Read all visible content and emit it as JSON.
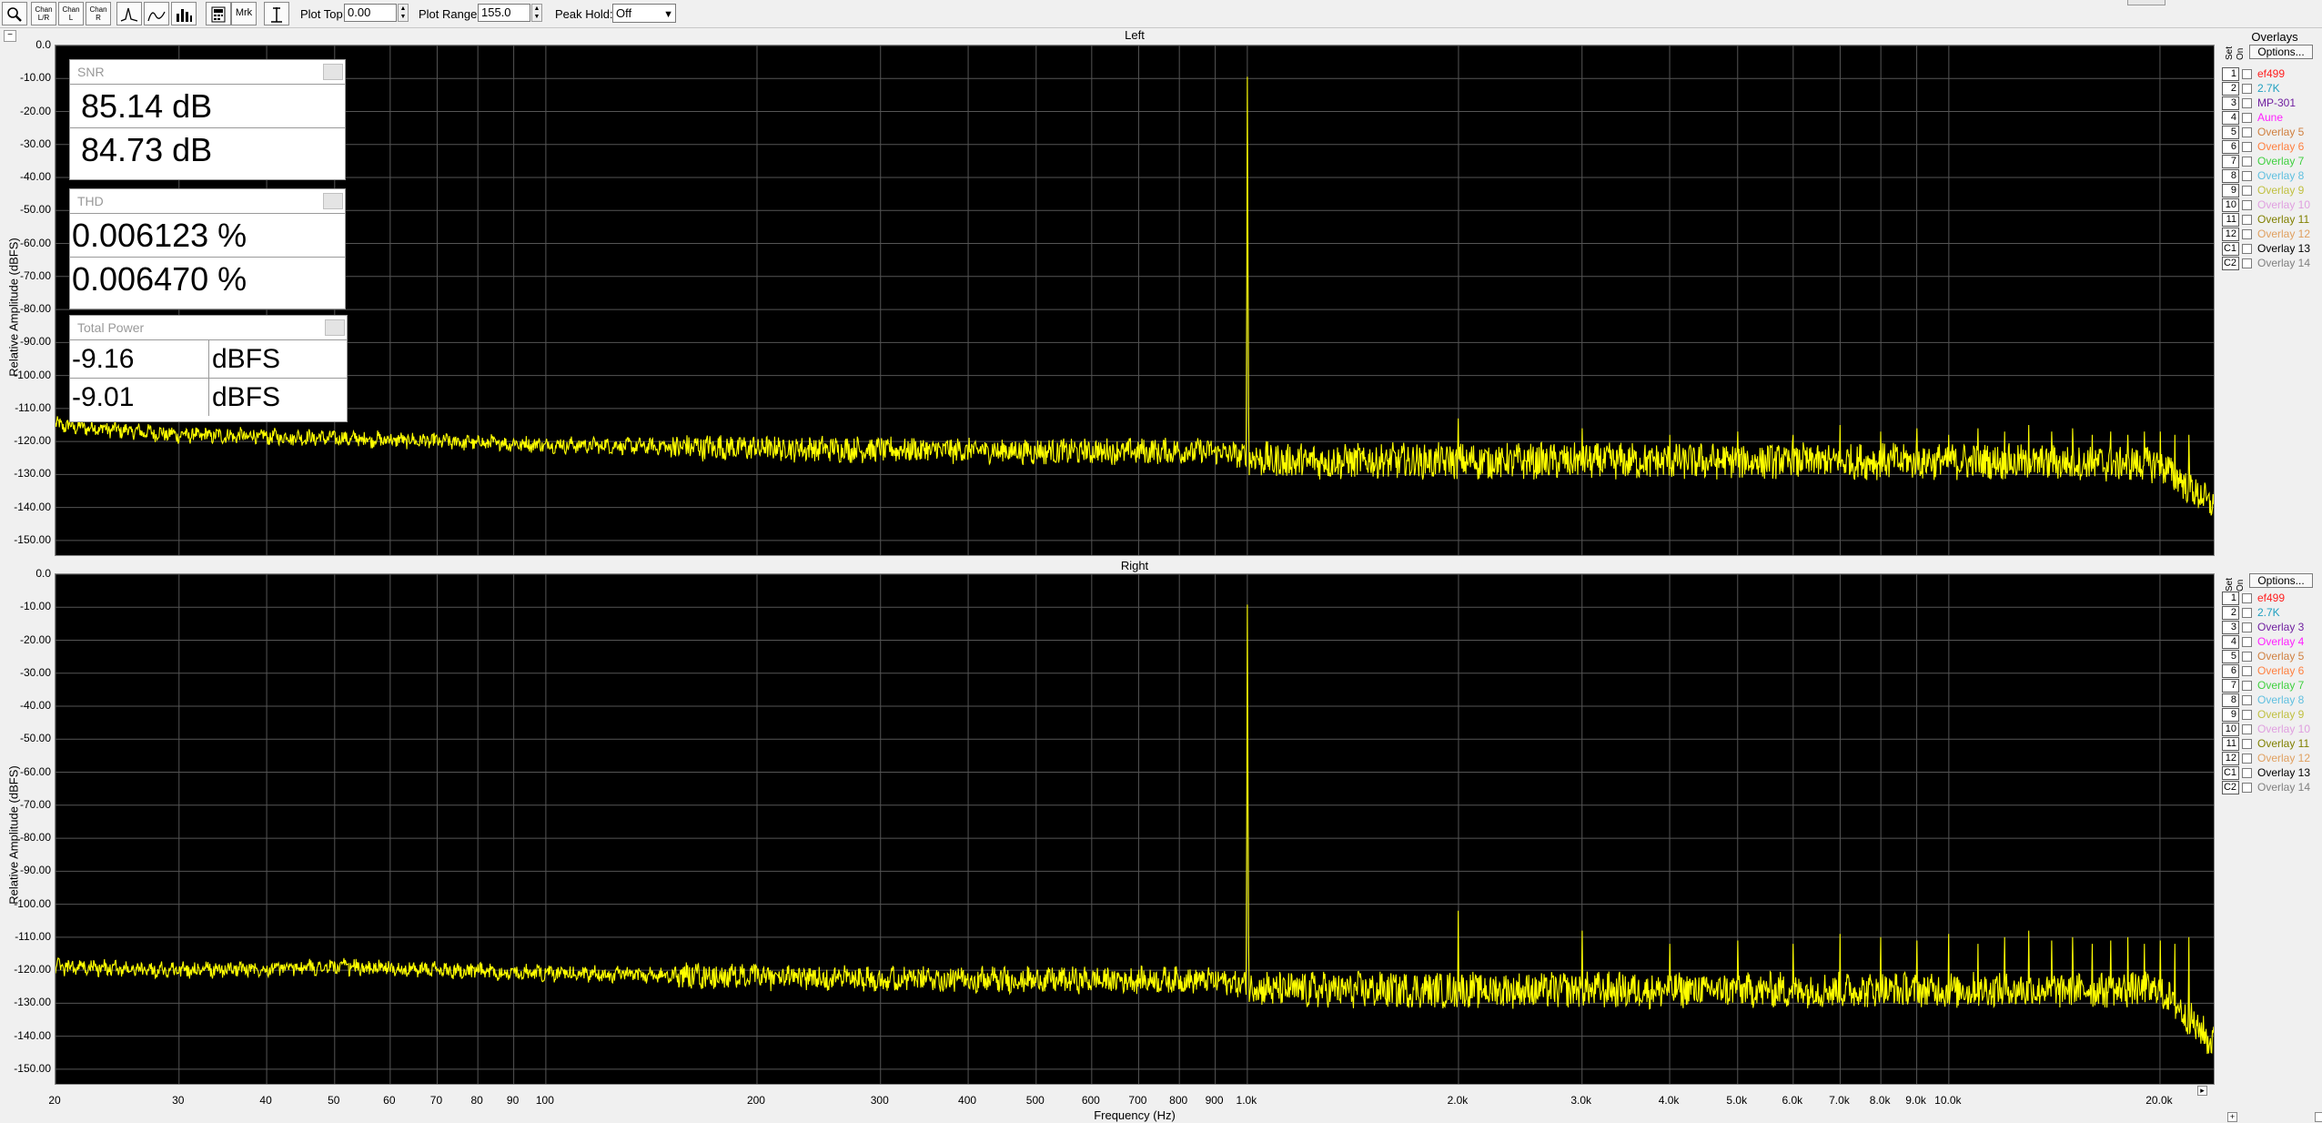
{
  "toolbar": {
    "buttons": [
      {
        "name": "zoom-tool-button",
        "label": "",
        "icon": "magnifier-icon"
      },
      {
        "name": "channel-both-button",
        "label": "Chan\nL/R",
        "icon": ""
      },
      {
        "name": "channel-left-button",
        "label": "Chan\nL",
        "icon": ""
      },
      {
        "name": "channel-right-button",
        "label": "Chan\nR",
        "icon": ""
      },
      {
        "name": "graph-mode-1-button",
        "label": "",
        "icon": "peak-graph-icon"
      },
      {
        "name": "graph-mode-2-button",
        "label": "",
        "icon": "curve-graph-icon"
      },
      {
        "name": "graph-mode-3-button",
        "label": "",
        "icon": "bars-graph-icon"
      },
      {
        "name": "calculator-button",
        "label": "",
        "icon": "calculator-icon"
      },
      {
        "name": "marker-button",
        "label": "Mrk",
        "icon": ""
      },
      {
        "name": "cursor-button",
        "label": "",
        "icon": "cursor-icon"
      }
    ],
    "plot_top_label": "Plot Top:",
    "plot_top_value": "0.00",
    "plot_range_label": "Plot Range:",
    "plot_range_value": "155.0",
    "peak_hold_label": "Peak Hold:",
    "peak_hold_value": "Off"
  },
  "colors": {
    "trace": "#ffff00",
    "grid": "#555555",
    "plot_bg": "#000000"
  },
  "panes": [
    {
      "title": "Left",
      "ylabel": "Relative Amplitude (dBFS)"
    },
    {
      "title": "Right",
      "ylabel": "Relative Amplitude (dBFS)"
    }
  ],
  "x_axis_title": "Frequency (Hz)",
  "x_tick_labels": [
    {
      "f": 20,
      "label": "20"
    },
    {
      "f": 30,
      "label": "30"
    },
    {
      "f": 40,
      "label": "40"
    },
    {
      "f": 50,
      "label": "50"
    },
    {
      "f": 60,
      "label": "60"
    },
    {
      "f": 70,
      "label": "70"
    },
    {
      "f": 80,
      "label": "80"
    },
    {
      "f": 90,
      "label": "90"
    },
    {
      "f": 100,
      "label": "100"
    },
    {
      "f": 200,
      "label": "200"
    },
    {
      "f": 300,
      "label": "300"
    },
    {
      "f": 400,
      "label": "400"
    },
    {
      "f": 500,
      "label": "500"
    },
    {
      "f": 600,
      "label": "600"
    },
    {
      "f": 700,
      "label": "700"
    },
    {
      "f": 800,
      "label": "800"
    },
    {
      "f": 900,
      "label": "900"
    },
    {
      "f": 1000,
      "label": "1.0k"
    },
    {
      "f": 2000,
      "label": "2.0k"
    },
    {
      "f": 3000,
      "label": "3.0k"
    },
    {
      "f": 4000,
      "label": "4.0k"
    },
    {
      "f": 5000,
      "label": "5.0k"
    },
    {
      "f": 6000,
      "label": "6.0k"
    },
    {
      "f": 7000,
      "label": "7.0k"
    },
    {
      "f": 8000,
      "label": "8.0k"
    },
    {
      "f": 9000,
      "label": "9.0k"
    },
    {
      "f": 10000,
      "label": "10.0k"
    },
    {
      "f": 20000,
      "label": "20.0k"
    }
  ],
  "y_tick_labels": [
    "0.0",
    "-10.00",
    "-20.00",
    "-30.00",
    "-40.00",
    "-50.00",
    "-60.00",
    "-70.00",
    "-80.00",
    "-90.00",
    "-100.00",
    "-110.00",
    "-120.00",
    "-130.00",
    "-140.00",
    "-150.00"
  ],
  "meters": {
    "snr": {
      "title": "SNR",
      "values": [
        "85.14 dB",
        "84.73 dB"
      ]
    },
    "thd": {
      "title": "THD",
      "values": [
        "0.006123 %",
        "0.006470 %"
      ]
    },
    "power": {
      "title": "Total Power",
      "rows": [
        {
          "value": "-9.16",
          "unit": "dBFS"
        },
        {
          "value": "-9.01",
          "unit": "dBFS"
        }
      ]
    }
  },
  "overlays": {
    "title": "Overlays",
    "set_label": "Set",
    "on_label": "On",
    "options_label": "Options...",
    "left": [
      {
        "num": "1",
        "name": "ef499",
        "color": "#ff2020"
      },
      {
        "num": "2",
        "name": "2.7K",
        "color": "#20a0c0"
      },
      {
        "num": "3",
        "name": "MP-301",
        "color": "#7020a0"
      },
      {
        "num": "4",
        "name": "Aune",
        "color": "#ff20ff"
      },
      {
        "num": "5",
        "name": "Overlay 5",
        "color": "#d08040"
      },
      {
        "num": "6",
        "name": "Overlay 6",
        "color": "#ff8040"
      },
      {
        "num": "7",
        "name": "Overlay 7",
        "color": "#40d040"
      },
      {
        "num": "8",
        "name": "Overlay 8",
        "color": "#60c0e0"
      },
      {
        "num": "9",
        "name": "Overlay 9",
        "color": "#c0c040"
      },
      {
        "num": "10",
        "name": "Overlay 10",
        "color": "#e0a0e0"
      },
      {
        "num": "11",
        "name": "Overlay 11",
        "color": "#808000"
      },
      {
        "num": "12",
        "name": "Overlay 12",
        "color": "#e0a060"
      },
      {
        "num": "C1",
        "name": "Overlay 13",
        "color": "#000000"
      },
      {
        "num": "C2",
        "name": "Overlay 14",
        "color": "#808080"
      }
    ],
    "right": [
      {
        "num": "1",
        "name": "ef499",
        "color": "#ff2020"
      },
      {
        "num": "2",
        "name": "2.7K",
        "color": "#20a0c0"
      },
      {
        "num": "3",
        "name": "Overlay 3",
        "color": "#7020a0"
      },
      {
        "num": "4",
        "name": "Overlay 4",
        "color": "#ff20ff"
      },
      {
        "num": "5",
        "name": "Overlay 5",
        "color": "#d08040"
      },
      {
        "num": "6",
        "name": "Overlay 6",
        "color": "#ff8040"
      },
      {
        "num": "7",
        "name": "Overlay 7",
        "color": "#40d040"
      },
      {
        "num": "8",
        "name": "Overlay 8",
        "color": "#60c0e0"
      },
      {
        "num": "9",
        "name": "Overlay 9",
        "color": "#c0c040"
      },
      {
        "num": "10",
        "name": "Overlay 10",
        "color": "#e0a0e0"
      },
      {
        "num": "11",
        "name": "Overlay 11",
        "color": "#808000"
      },
      {
        "num": "12",
        "name": "Overlay 12",
        "color": "#e0a060"
      },
      {
        "num": "C1",
        "name": "Overlay 13",
        "color": "#000000"
      },
      {
        "num": "C2",
        "name": "Overlay 14",
        "color": "#808080"
      }
    ]
  },
  "chart_data": [
    {
      "type": "line",
      "title": "Left",
      "xlabel": "Frequency (Hz)",
      "ylabel": "Relative Amplitude (dBFS)",
      "xscale": "log",
      "xlim": [
        20,
        24000
      ],
      "ylim": [
        -155,
        0
      ],
      "grid": true,
      "noise_floor": [
        [
          20,
          -115
        ],
        [
          30,
          -118
        ],
        [
          50,
          -119
        ],
        [
          100,
          -121
        ],
        [
          200,
          -122
        ],
        [
          500,
          -123
        ],
        [
          900,
          -123
        ],
        [
          1100,
          -126
        ],
        [
          5000,
          -126
        ],
        [
          10000,
          -126
        ],
        [
          20000,
          -127
        ],
        [
          24000,
          -140
        ]
      ],
      "peaks": [
        [
          1000,
          -9.5
        ],
        [
          2000,
          -113
        ],
        [
          3000,
          -116
        ],
        [
          4000,
          -118
        ],
        [
          5000,
          -117
        ],
        [
          6000,
          -118
        ],
        [
          7000,
          -115
        ],
        [
          8000,
          -117
        ],
        [
          9000,
          -116
        ],
        [
          10000,
          -118
        ],
        [
          11000,
          -116
        ],
        [
          12000,
          -117
        ],
        [
          13000,
          -115
        ],
        [
          14000,
          -117
        ],
        [
          15000,
          -116
        ],
        [
          16000,
          -118
        ],
        [
          17000,
          -117
        ],
        [
          18000,
          -118
        ],
        [
          19000,
          -117
        ],
        [
          20000,
          -117
        ],
        [
          21000,
          -118
        ],
        [
          22000,
          -118
        ]
      ]
    },
    {
      "type": "line",
      "title": "Right",
      "xlabel": "Frequency (Hz)",
      "ylabel": "Relative Amplitude (dBFS)",
      "xscale": "log",
      "xlim": [
        20,
        24000
      ],
      "ylim": [
        -155,
        0
      ],
      "grid": true,
      "noise_floor": [
        [
          20,
          -119
        ],
        [
          30,
          -120
        ],
        [
          50,
          -119
        ],
        [
          100,
          -121
        ],
        [
          200,
          -122
        ],
        [
          500,
          -123
        ],
        [
          900,
          -123
        ],
        [
          1100,
          -126
        ],
        [
          5000,
          -126
        ],
        [
          10000,
          -126
        ],
        [
          20000,
          -126
        ],
        [
          24000,
          -143
        ]
      ],
      "peaks": [
        [
          1000,
          -9.2
        ],
        [
          2000,
          -102
        ],
        [
          3000,
          -108
        ],
        [
          4000,
          -112
        ],
        [
          5000,
          -111
        ],
        [
          6000,
          -112
        ],
        [
          7000,
          -109
        ],
        [
          8000,
          -110
        ],
        [
          9000,
          -111
        ],
        [
          10000,
          -109
        ],
        [
          11000,
          -112
        ],
        [
          12000,
          -110
        ],
        [
          13000,
          -108
        ],
        [
          14000,
          -111
        ],
        [
          15000,
          -110
        ],
        [
          16000,
          -112
        ],
        [
          17000,
          -111
        ],
        [
          18000,
          -110
        ],
        [
          19000,
          -112
        ],
        [
          20000,
          -111
        ],
        [
          21000,
          -112
        ],
        [
          22000,
          -110
        ]
      ]
    }
  ]
}
